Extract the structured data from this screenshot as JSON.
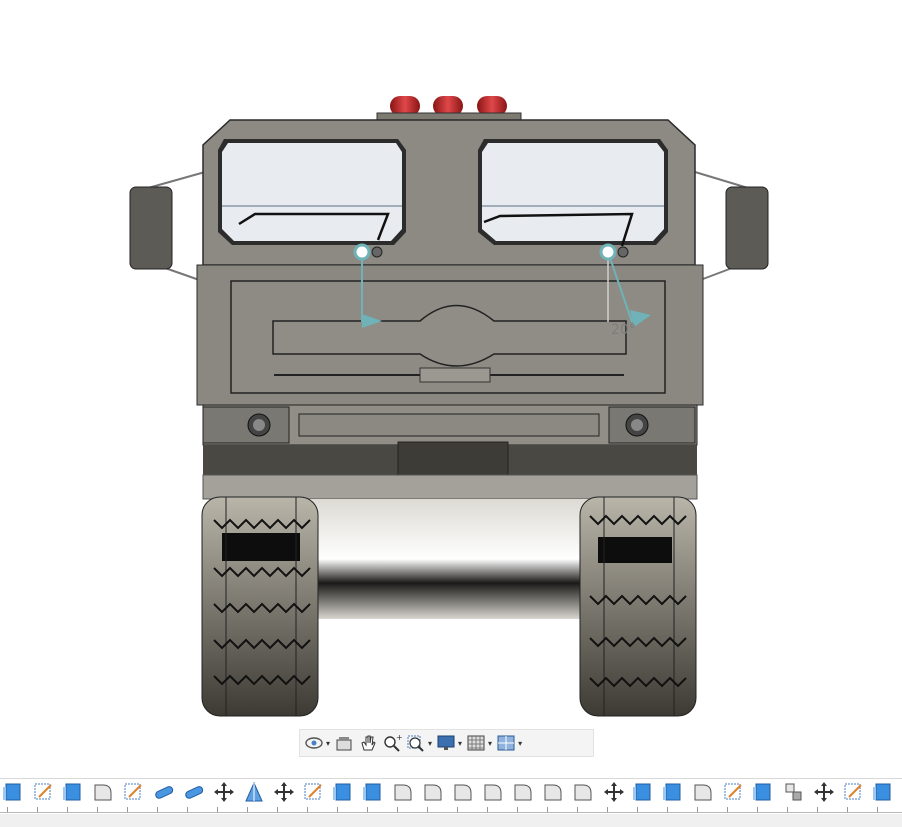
{
  "viewport": {
    "model": "front-view-truck",
    "dimension_annotation": "20°",
    "colors": {
      "body": "#8a8880",
      "body_dark": "#4a4842",
      "glass": "#e6eaef",
      "beacon": "#c2262a",
      "handle": "#6fb3b8",
      "tire": "#3a3833"
    }
  },
  "nav_toolbar": {
    "items": [
      {
        "name": "orbit",
        "icon": "orbit-icon",
        "has_dropdown": true
      },
      {
        "name": "look-at",
        "icon": "camera-icon",
        "has_dropdown": false
      },
      {
        "name": "pan",
        "icon": "hand-icon",
        "has_dropdown": false
      },
      {
        "name": "zoom",
        "icon": "zoom-icon",
        "has_dropdown": false
      },
      {
        "name": "fit",
        "icon": "zoom-window-icon",
        "has_dropdown": true
      },
      {
        "name": "display-settings",
        "icon": "monitor-icon",
        "has_dropdown": true
      },
      {
        "name": "grid-and-snaps",
        "icon": "grid-icon",
        "has_dropdown": true
      },
      {
        "name": "viewports",
        "icon": "viewports-icon",
        "has_dropdown": true
      }
    ]
  },
  "timeline": {
    "features": [
      "extrude-icon",
      "sketch-icon",
      "extrude-icon",
      "fillet-icon",
      "sketch-icon",
      "pipe-icon",
      "pipe-icon",
      "move-icon",
      "draft-icon",
      "move-icon",
      "sketch-icon",
      "extrude-icon",
      "extrude-icon",
      "fillet-icon",
      "fillet-icon",
      "fillet-icon",
      "fillet-icon",
      "fillet-icon",
      "fillet-icon",
      "fillet-icon",
      "move-icon",
      "extrude-icon",
      "extrude-icon",
      "fillet-icon",
      "sketch-icon",
      "extrude-icon",
      "joint-icon",
      "move-icon",
      "sketch-icon",
      "extrude-icon"
    ]
  }
}
